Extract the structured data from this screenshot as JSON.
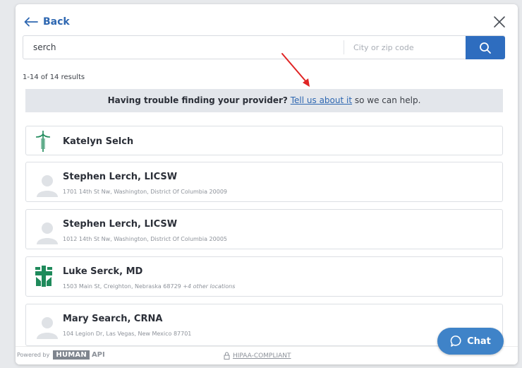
{
  "header": {
    "back_label": "Back"
  },
  "search": {
    "query_value": "serch",
    "location_placeholder": "City or zip code"
  },
  "results": {
    "count_text": "1-14 of 14 results"
  },
  "trouble_banner": {
    "prefix": "Having trouble finding your provider?",
    "link": "Tell us about it",
    "suffix": " so we can help."
  },
  "providers": [
    {
      "name": "Katelyn Selch",
      "address": "",
      "extra": "",
      "avatar": "cross-logo-icon"
    },
    {
      "name": "Stephen Lerch, LICSW",
      "address": "1701 14th St Nw, Washington, District Of Columbia 20009",
      "extra": "",
      "avatar": "person-placeholder-icon"
    },
    {
      "name": "Stephen Lerch, LICSW",
      "address": "1012 14th St Nw, Washington, District Of Columbia 20005",
      "extra": "",
      "avatar": "person-placeholder-icon"
    },
    {
      "name": "Luke Serck, MD",
      "address": "1503 Main St, Creighton, Nebraska 68729",
      "extra": "+4 other locations",
      "avatar": "hospital-logo-icon"
    },
    {
      "name": "Mary Search, CRNA",
      "address": "104 Legion Dr, Las Vegas, New Mexico 87701",
      "extra": "",
      "avatar": "person-placeholder-icon"
    }
  ],
  "footer": {
    "powered_by": "Powered by",
    "brand": "HUMAN",
    "api": "API",
    "hipaa": "HIPAA-COMPLIANT"
  },
  "chat": {
    "label": "Chat"
  },
  "colors": {
    "accent_blue": "#2e6dbf",
    "link_blue": "#2e67b1",
    "chat_blue": "#3f83c8",
    "annotation_red": "#e02424",
    "logo_green": "#1f8a5b"
  }
}
